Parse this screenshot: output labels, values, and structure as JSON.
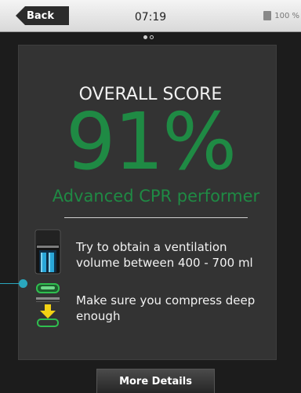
{
  "topbar": {
    "back_label": "Back",
    "time": "07:19",
    "battery": "100 %"
  },
  "result": {
    "title": "OVERALL SCORE",
    "score": "91%",
    "level": "Advanced CPR performer"
  },
  "tips": [
    {
      "icon": "ventilation-lungs-icon",
      "text": "Try to obtain a ventilation volume between 400 - 700 ml"
    },
    {
      "icon": "compression-depth-icon",
      "text": "Make sure you compress deep enough"
    }
  ],
  "footer": {
    "more_label": "More Details"
  },
  "colors": {
    "score": "#1f8a44",
    "accent": "#2aa7bd",
    "card": "#333333"
  }
}
